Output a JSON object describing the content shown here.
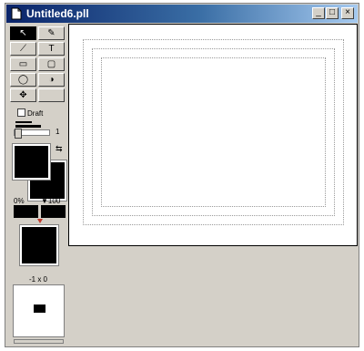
{
  "window": {
    "title": "Untitled6.pll",
    "minimize_glyph": "_",
    "maximize_glyph": "□",
    "close_glyph": "×"
  },
  "toolbox": {
    "tools": [
      {
        "name": "arrow-tool",
        "glyph": "↖",
        "selected": true
      },
      {
        "name": "eyedropper-tool",
        "glyph": "✎",
        "selected": false
      },
      {
        "name": "line-tool",
        "glyph": "⟋",
        "selected": false
      },
      {
        "name": "text-tool",
        "glyph": "T",
        "selected": false
      },
      {
        "name": "rectangle-tool",
        "glyph": "▭",
        "selected": false
      },
      {
        "name": "rounded-rect-tool",
        "glyph": "▢",
        "selected": false
      },
      {
        "name": "oval-tool",
        "glyph": "◯",
        "selected": false
      },
      {
        "name": "polygon-tool",
        "glyph": "◑",
        "selected": false
      },
      {
        "name": "move-tool",
        "glyph": "✥",
        "selected": false
      }
    ],
    "draft_label": "Draft",
    "slider_value": "1",
    "swap_glyph": "⇆",
    "pct_left": "0%",
    "pct_right": "▼100",
    "coordinates": "-1 x 0"
  },
  "colors": {
    "title_start": "#0a246a",
    "chrome": "#d4d0c8",
    "swatch": "#000000",
    "gradient_marker": "#c0392b"
  }
}
